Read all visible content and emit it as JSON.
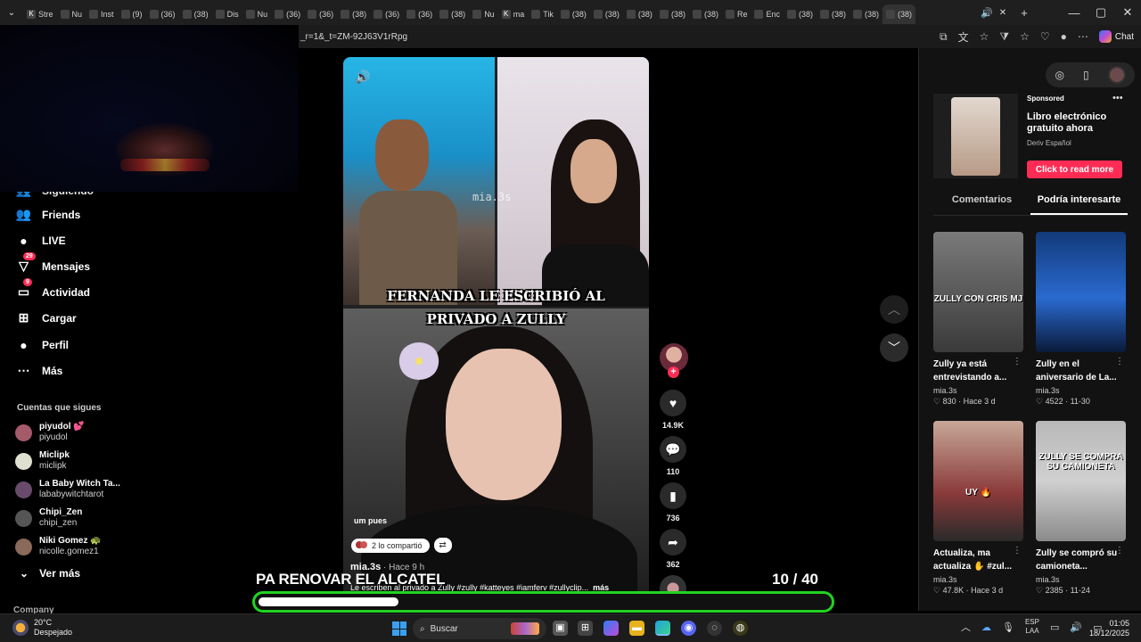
{
  "browser": {
    "tabs": [
      {
        "icon": "K",
        "label": "Stre"
      },
      {
        "icon": "",
        "label": "Nu"
      },
      {
        "icon": "",
        "label": "Inst"
      },
      {
        "icon": "",
        "label": "(9)"
      },
      {
        "icon": "",
        "label": "(36)"
      },
      {
        "icon": "",
        "label": "(38)"
      },
      {
        "icon": "",
        "label": "Dis"
      },
      {
        "icon": "",
        "label": "Nu"
      },
      {
        "icon": "",
        "label": "(36)"
      },
      {
        "icon": "",
        "label": "(36)"
      },
      {
        "icon": "",
        "label": "(38)"
      },
      {
        "icon": "",
        "label": "(36)"
      },
      {
        "icon": "",
        "label": "(36)"
      },
      {
        "icon": "",
        "label": "(38)"
      },
      {
        "icon": "",
        "label": "Nu"
      },
      {
        "icon": "K",
        "label": "ma"
      },
      {
        "icon": "",
        "label": "Tik"
      },
      {
        "icon": "",
        "label": "(38)"
      },
      {
        "icon": "",
        "label": "(38)"
      },
      {
        "icon": "",
        "label": "(38)"
      },
      {
        "icon": "",
        "label": "(38)"
      },
      {
        "icon": "",
        "label": "(38)"
      },
      {
        "icon": "",
        "label": "Re"
      },
      {
        "icon": "",
        "label": "Enc"
      },
      {
        "icon": "",
        "label": "(38)"
      },
      {
        "icon": "",
        "label": "(38)"
      },
      {
        "icon": "",
        "label": "(38)"
      },
      {
        "icon": "",
        "label": "(38)"
      }
    ],
    "new_tab": "+",
    "win_min": "—",
    "win_max": "▢",
    "win_close": "✕",
    "tab_close": "✕",
    "address": "_r=1&_t=ZM-92J63V1rRpg",
    "chat_label": "Chat"
  },
  "sidebar": {
    "partial_item": "Siguiendo",
    "items": [
      {
        "icon": "friends-icon",
        "glyph": "👥",
        "label": "Friends",
        "badge": ""
      },
      {
        "icon": "live-icon",
        "glyph": "●",
        "label": "LIVE",
        "badge": ""
      },
      {
        "icon": "messages-icon",
        "glyph": "▽",
        "label": "Mensajes",
        "badge": "29"
      },
      {
        "icon": "activity-icon",
        "glyph": "▭",
        "label": "Actividad",
        "badge": "9"
      },
      {
        "icon": "upload-icon",
        "glyph": "⊞",
        "label": "Cargar",
        "badge": ""
      },
      {
        "icon": "profile-icon",
        "glyph": "●",
        "label": "Perfil",
        "badge": ""
      },
      {
        "icon": "more-icon",
        "glyph": "⋯",
        "label": "Más",
        "badge": ""
      }
    ],
    "following_title": "Cuentas que sigues",
    "following": [
      {
        "name": "piyudol 💕",
        "handle": "piyudol"
      },
      {
        "name": "Miclipk",
        "handle": "miclipk"
      },
      {
        "name": "La Baby Witch Ta...",
        "handle": "lababywitchtarot"
      },
      {
        "name": "Chipi_Zen",
        "handle": "chipi_zen"
      },
      {
        "name": "Niki Gomez 🐢",
        "handle": "nicolle.gomez1"
      }
    ],
    "see_more": "Ver más",
    "company": "Company"
  },
  "video": {
    "watermark": "mia.3s",
    "caption_line1": "FERNANDA LE ESCRIBIÓ AL",
    "caption_line2": "PRIVADO A ZULLY",
    "subtitle": "um pues",
    "shared_label": "2 lo compartió",
    "author": "mia.3s",
    "time": " · Hace 9 h",
    "description": "Le escriben al privado a Zully #zully #katteyes #iamferv #zullyclip...",
    "more": "más"
  },
  "actions": {
    "likes": "14.9K",
    "comments": "110",
    "saves": "736",
    "shares": "362"
  },
  "nav": {
    "up": "︿",
    "down": "﹀"
  },
  "right_panel": {
    "ad": {
      "sponsored": "Sponsored",
      "title": "Libro electrónico gratuito ahora",
      "brand": "Deriv Español",
      "cta": "Click to read more",
      "menu": "•••"
    },
    "tabs": [
      "Comentarios",
      "Podría interesarte"
    ],
    "cards": [
      {
        "overlay": "ZULLY CON CRIS MJ",
        "title": "Zully ya está entrevistando a...",
        "author": "mia.3s",
        "stats": "♡ 830 · Hace 3 d"
      },
      {
        "overlay": "",
        "title": "Zully en el aniversario de La...",
        "author": "mia.3s",
        "stats": "♡ 4522 · 11-30"
      },
      {
        "overlay": "UY 🔥",
        "title": "Actualiza, ma actualiza ✋ #zul...",
        "author": "mia.3s",
        "stats": "♡ 47.8K · Hace 3 d"
      },
      {
        "overlay": "ZULLY SE COMPRA SU CAMIONETA",
        "title": "Zully se compró su camioneta...",
        "author": "mia.3s",
        "stats": "♡ 2385 · 11-24"
      }
    ]
  },
  "overlay": {
    "big_text": "PA RENOVAR EL ALCATEL",
    "counter": "10  / 40",
    "progress_fraction": 0.245
  },
  "taskbar": {
    "temp": "20°C",
    "weather": "Despejado",
    "search": "Buscar",
    "lang1": "ESP",
    "lang2": "LAA",
    "time": "01:05",
    "date": "18/12/2025"
  }
}
